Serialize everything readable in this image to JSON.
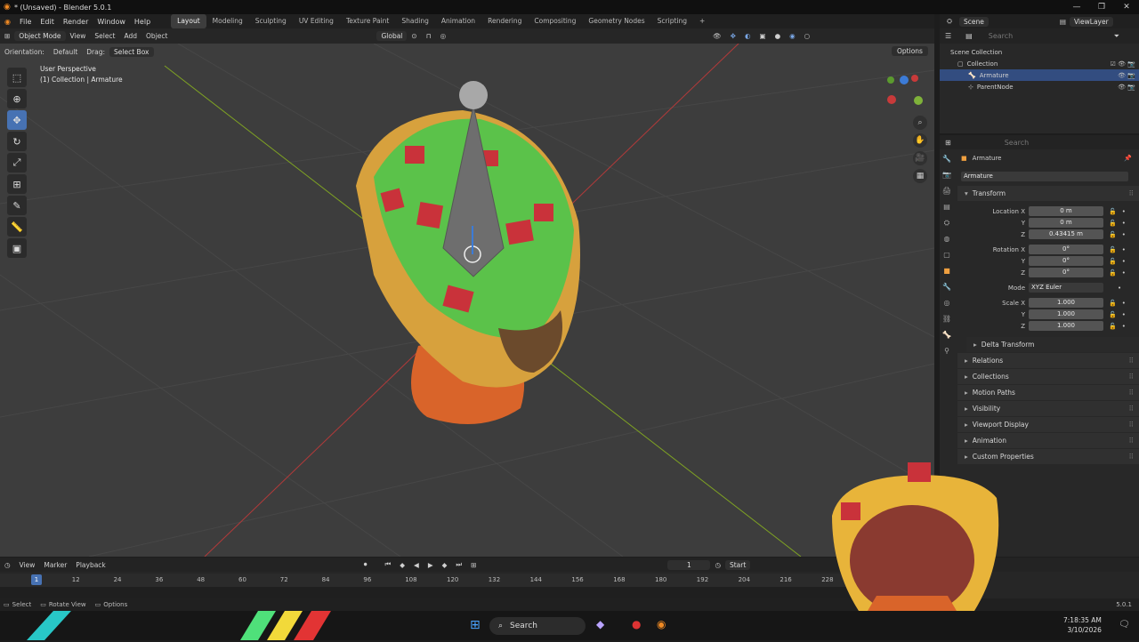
{
  "titlebar": {
    "title": "* (Unsaved) - Blender 5.0.1"
  },
  "menu": {
    "items": [
      "File",
      "Edit",
      "Render",
      "Window",
      "Help"
    ],
    "workspaces": [
      "Layout",
      "Modeling",
      "Sculpting",
      "UV Editing",
      "Texture Paint",
      "Shading",
      "Animation",
      "Rendering",
      "Compositing",
      "Geometry Nodes",
      "Scripting"
    ],
    "active_workspace": "Layout"
  },
  "scene": {
    "scene_label": "Scene",
    "viewlayer_label": "ViewLayer"
  },
  "viewport_header": {
    "mode": "Object Mode",
    "view": "View",
    "select": "Select",
    "add": "Add",
    "object": "Object",
    "transform_orientation": "Global",
    "orientation_label": "Orientation:",
    "orientation_value": "Default",
    "drag_label": "Drag:",
    "drag_value": "Select Box",
    "options": "Options"
  },
  "viewport_info": {
    "line1": "User Perspective",
    "line2": "(1) Collection | Armature"
  },
  "outliner": {
    "search_placeholder": "Search",
    "root": "Scene Collection",
    "collection": "Collection",
    "items": [
      {
        "name": "Armature",
        "selected": true
      },
      {
        "name": "ParentNode",
        "selected": false
      }
    ]
  },
  "properties": {
    "search_placeholder": "Search",
    "object_name": "Armature",
    "data_name": "Armature",
    "transform_title": "Transform",
    "location": {
      "label": "Location X",
      "x": "0 m",
      "y": "0 m",
      "z": "0.43415 m"
    },
    "rotation": {
      "label": "Rotation X",
      "x": "0°",
      "y": "0°",
      "z": "0°"
    },
    "mode": {
      "label": "Mode",
      "value": "XYZ Euler"
    },
    "scale": {
      "label": "Scale X",
      "x": "1.000",
      "y": "1.000",
      "z": "1.000"
    },
    "axis_y": "Y",
    "axis_z": "Z",
    "delta_transform": "Delta Transform",
    "panels": [
      "Relations",
      "Collections",
      "Motion Paths",
      "Visibility",
      "Viewport Display",
      "Animation",
      "Custom Properties"
    ]
  },
  "timeline": {
    "view": "View",
    "marker": "Marker",
    "playback": "Playback",
    "current_frame": "1",
    "start_label": "Start",
    "ticks": [
      "1",
      "12",
      "24",
      "36",
      "48",
      "60",
      "72",
      "84",
      "96",
      "108",
      "120",
      "132",
      "144",
      "156",
      "168",
      "180",
      "192",
      "204",
      "216",
      "228"
    ]
  },
  "statusbar": {
    "select": "Select",
    "rotate_view": "Rotate View",
    "options": "Options",
    "version": "5.0.1"
  },
  "taskbar": {
    "search": "Search",
    "time": "7:18:35 AM",
    "date": "3/10/2026"
  },
  "colors": {
    "accent": "#4772b3",
    "viewport_bg": "#3d3d3d",
    "x_axis": "#b33a3a",
    "y_axis": "#7fa323"
  }
}
